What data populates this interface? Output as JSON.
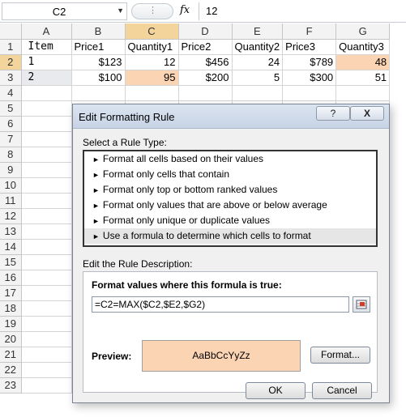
{
  "formula_bar": {
    "name_box": "C2",
    "fx_label": "fx",
    "value": "12"
  },
  "grid": {
    "columns": [
      "A",
      "B",
      "C",
      "D",
      "E",
      "F",
      "G"
    ],
    "rows": [
      {
        "num": "1",
        "cells": [
          "Item",
          "Price1",
          "Quantity1",
          "Price2",
          "Quantity2",
          "Price3",
          "Quantity3"
        ]
      },
      {
        "num": "2",
        "cells": [
          "1",
          "$123",
          "12",
          "$456",
          "24",
          "$789",
          "48"
        ]
      },
      {
        "num": "3",
        "cells": [
          "2",
          "$100",
          "95",
          "$200",
          "5",
          "$300",
          "51"
        ]
      },
      {
        "num": "4",
        "cells": [
          "",
          "",
          "",
          "",
          "",
          "",
          ""
        ]
      },
      {
        "num": "5",
        "cells": [
          "",
          "",
          "",
          "",
          "",
          "",
          ""
        ]
      },
      {
        "num": "6",
        "cells": [
          "",
          "",
          "",
          "",
          "",
          "",
          ""
        ]
      },
      {
        "num": "7",
        "cells": [
          "",
          "",
          "",
          "",
          "",
          "",
          ""
        ]
      },
      {
        "num": "8",
        "cells": [
          "",
          "",
          "",
          "",
          "",
          "",
          ""
        ]
      },
      {
        "num": "9",
        "cells": [
          "",
          "",
          "",
          "",
          "",
          "",
          ""
        ]
      },
      {
        "num": "10",
        "cells": [
          "",
          "",
          "",
          "",
          "",
          "",
          ""
        ]
      },
      {
        "num": "11",
        "cells": [
          "",
          "",
          "",
          "",
          "",
          "",
          ""
        ]
      },
      {
        "num": "12",
        "cells": [
          "",
          "",
          "",
          "",
          "",
          "",
          ""
        ]
      },
      {
        "num": "13",
        "cells": [
          "",
          "",
          "",
          "",
          "",
          "",
          ""
        ]
      },
      {
        "num": "14",
        "cells": [
          "",
          "",
          "",
          "",
          "",
          "",
          ""
        ]
      },
      {
        "num": "15",
        "cells": [
          "",
          "",
          "",
          "",
          "",
          "",
          ""
        ]
      },
      {
        "num": "16",
        "cells": [
          "",
          "",
          "",
          "",
          "",
          "",
          ""
        ]
      },
      {
        "num": "17",
        "cells": [
          "",
          "",
          "",
          "",
          "",
          "",
          ""
        ]
      },
      {
        "num": "18",
        "cells": [
          "",
          "",
          "",
          "",
          "",
          "",
          ""
        ]
      },
      {
        "num": "19",
        "cells": [
          "",
          "",
          "",
          "",
          "",
          "",
          ""
        ]
      },
      {
        "num": "20",
        "cells": [
          "",
          "",
          "",
          "",
          "",
          "",
          ""
        ]
      },
      {
        "num": "21",
        "cells": [
          "",
          "",
          "",
          "",
          "",
          "",
          ""
        ]
      },
      {
        "num": "22",
        "cells": [
          "",
          "",
          "",
          "",
          "",
          "",
          ""
        ]
      },
      {
        "num": "23",
        "cells": [
          "",
          "",
          "",
          "",
          "",
          "",
          ""
        ]
      }
    ],
    "highlight_color": "#fbd4b4"
  },
  "dialog": {
    "title": "Edit Formatting Rule",
    "help_label": "?",
    "close_label": "X",
    "select_rule_type_label": "Select a Rule Type:",
    "rule_types": [
      "Format all cells based on their values",
      "Format only cells that contain",
      "Format only top or bottom ranked values",
      "Format only values that are above or below average",
      "Format only unique or duplicate values",
      "Use a formula to determine which cells to format"
    ],
    "selected_rule_index": 5,
    "edit_description_label": "Edit the Rule Description:",
    "formula_label": "Format values where this formula is true:",
    "formula_value": "=C2=MAX($C2,$E2,$G2)",
    "preview_label": "Preview:",
    "preview_sample": "AaBbCcYyZz",
    "format_button": "Format...",
    "ok_button": "OK",
    "cancel_button": "Cancel"
  }
}
